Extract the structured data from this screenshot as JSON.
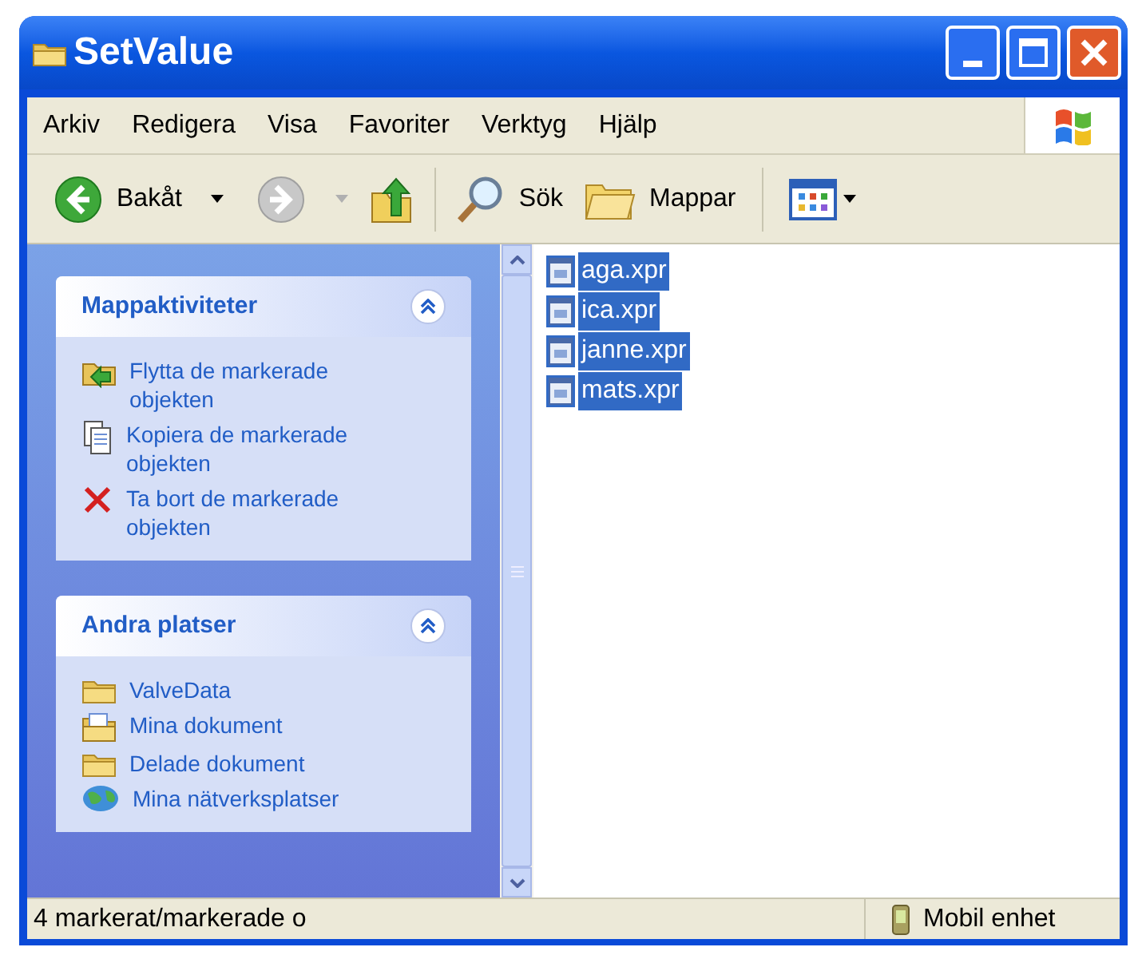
{
  "window": {
    "title": "SetValue"
  },
  "menu": [
    "Arkiv",
    "Redigera",
    "Visa",
    "Favoriter",
    "Verktyg",
    "Hjälp"
  ],
  "toolbar": [
    {
      "kind": "back",
      "label": "Bakåt",
      "disabled": false
    },
    {
      "kind": "forward",
      "disabled": true
    },
    {
      "kind": "up"
    },
    {
      "kind": "search",
      "label": "Sök"
    },
    {
      "kind": "folders",
      "label": "Mappar"
    },
    {
      "kind": "views"
    }
  ],
  "task_panels": [
    {
      "title": "Mappaktiviteter",
      "items": [
        {
          "kind": "move",
          "label": "Flytta de markerade objekten"
        },
        {
          "kind": "copy",
          "label": "Kopiera de markerade objekten"
        },
        {
          "kind": "delete",
          "label": "Ta bort de markerade objekten"
        }
      ]
    },
    {
      "title": "Andra platser",
      "items": [
        {
          "kind": "folder",
          "label": "ValveData"
        },
        {
          "kind": "documents",
          "label": "Mina dokument"
        },
        {
          "kind": "folder",
          "label": "Delade dokument"
        },
        {
          "kind": "network",
          "label": "Mina nätverksplatser"
        }
      ]
    }
  ],
  "files": [
    {
      "name": "aga.xpr",
      "selected": true
    },
    {
      "name": "ica.xpr",
      "selected": true
    },
    {
      "name": "janne.xpr",
      "selected": true
    },
    {
      "name": "mats.xpr",
      "selected": true
    }
  ],
  "status_bar": {
    "text": "4 markerat/markerade o",
    "zone": "Mobil enhet"
  }
}
